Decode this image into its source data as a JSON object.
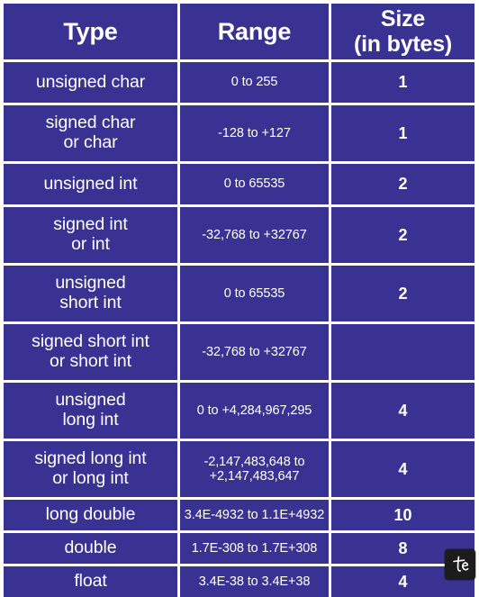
{
  "table": {
    "headers": [
      {
        "label": "Type"
      },
      {
        "label": "Range"
      },
      {
        "label": "Size",
        "label_line2": "(in bytes)"
      }
    ],
    "rows": [
      {
        "type": "unsigned char",
        "type_line2": "",
        "range": "0 to 255",
        "range_line2": "",
        "size": "1"
      },
      {
        "type": "signed char",
        "type_line2": "or char",
        "range": "-128 to +127",
        "range_line2": "",
        "size": "1"
      },
      {
        "type": "unsigned int",
        "type_line2": "",
        "range": "0 to 65535",
        "range_line2": "",
        "size": "2"
      },
      {
        "type": "signed int",
        "type_line2": "or int",
        "range": "-32,768 to +32767",
        "range_line2": "",
        "size": "2"
      },
      {
        "type": "unsigned",
        "type_line2": "short int",
        "range": "0 to 65535",
        "range_line2": "",
        "size": "2"
      },
      {
        "type": "signed short int",
        "type_line2": "or short int",
        "range": "-32,768 to +32767",
        "range_line2": "",
        "size": ""
      },
      {
        "type": "unsigned",
        "type_line2": "long int",
        "range": "0 to +4,284,967,295",
        "range_line2": "",
        "size": "4"
      },
      {
        "type": "signed long int",
        "type_line2": "or long int",
        "range": "-2,147,483,648 to",
        "range_line2": "+2,147,483,647",
        "size": "4"
      },
      {
        "type": "long double",
        "type_line2": "",
        "range": "3.4E-4932 to 1.1E+4932",
        "range_line2": "",
        "size": "10"
      },
      {
        "type": "double",
        "type_line2": "",
        "range": "1.7E-308 to 1.7E+308",
        "range_line2": "",
        "size": "8"
      },
      {
        "type": "float",
        "type_line2": "",
        "range": "3.4E-38 to 3.4E+38",
        "range_line2": "",
        "size": "4"
      }
    ]
  },
  "branding": {
    "logo_text": "te"
  },
  "colors": {
    "cell_background": "#393293",
    "text": "#ffffff",
    "grid_line": "#fefefa",
    "page_background": "#fefefa",
    "logo_background": "#1c1c1c"
  }
}
